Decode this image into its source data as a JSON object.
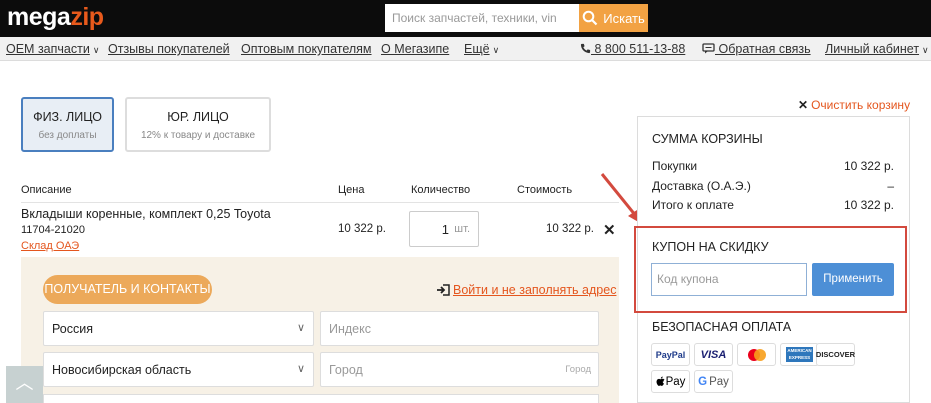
{
  "header": {
    "logo_part1": "mega",
    "logo_part2": "zip",
    "search_placeholder": "Поиск запчастей, техники, vin",
    "search_button": "Искать"
  },
  "nav": {
    "oem": "OEM запчасти",
    "reviews": "Отзывы покупателей",
    "wholesale": "Оптовым покупателям",
    "about": "О Мегазипе",
    "more": "Ещё",
    "phone": "8 800 511-13-88",
    "feedback": "Обратная связь",
    "account": "Личный кабинет"
  },
  "cart": {
    "clear_label": "Очистить корзину",
    "person_types": [
      {
        "title": "ФИЗ. ЛИЦО",
        "subtitle": "без доплаты"
      },
      {
        "title": "ЮР. ЛИЦО",
        "subtitle": "12% к товару и доставке"
      }
    ],
    "columns": {
      "description": "Описание",
      "price": "Цена",
      "quantity": "Количество",
      "total": "Стоимость"
    },
    "item": {
      "name": "Вкладыши коренные, комплект 0,25 Toyota",
      "code": "11704-21020",
      "stock": "Склад ОАЭ",
      "price": "10 322 р.",
      "quantity": "1",
      "unit": "шт.",
      "total": "10 322 р."
    }
  },
  "form": {
    "recipient_button": "ПОЛУЧАТЕЛЬ И КОНТАКТЫ",
    "login_link": "Войти и не заполнять адрес",
    "country": "Россия",
    "index_placeholder": "Индекс",
    "region": "Новосибирская область",
    "city_placeholder": "Город",
    "city_hint": "Город"
  },
  "summary": {
    "title": "СУММА КОРЗИНЫ",
    "rows": [
      {
        "label": "Покупки",
        "value": "10 322 р."
      },
      {
        "label": "Доставка (О.А.Э.)",
        "value": "–"
      },
      {
        "label": "Итого к оплате",
        "value": "10 322 р."
      }
    ],
    "coupon_title": "КУПОН НА СКИДКУ",
    "coupon_placeholder": "Код купона",
    "apply_button": "Применить",
    "secure_title": "БЕЗОПАСНАЯ ОПЛАТА",
    "payment_methods": [
      "PayPal",
      "VISA",
      "Mastercard",
      "American Express",
      "DISCOVER",
      "Apple Pay",
      "Google Pay"
    ]
  },
  "colors": {
    "accent_orange": "#e4561e",
    "button_orange": "#eca95a",
    "apply_blue": "#4d8fd6",
    "highlight_red": "#d34a3e"
  }
}
